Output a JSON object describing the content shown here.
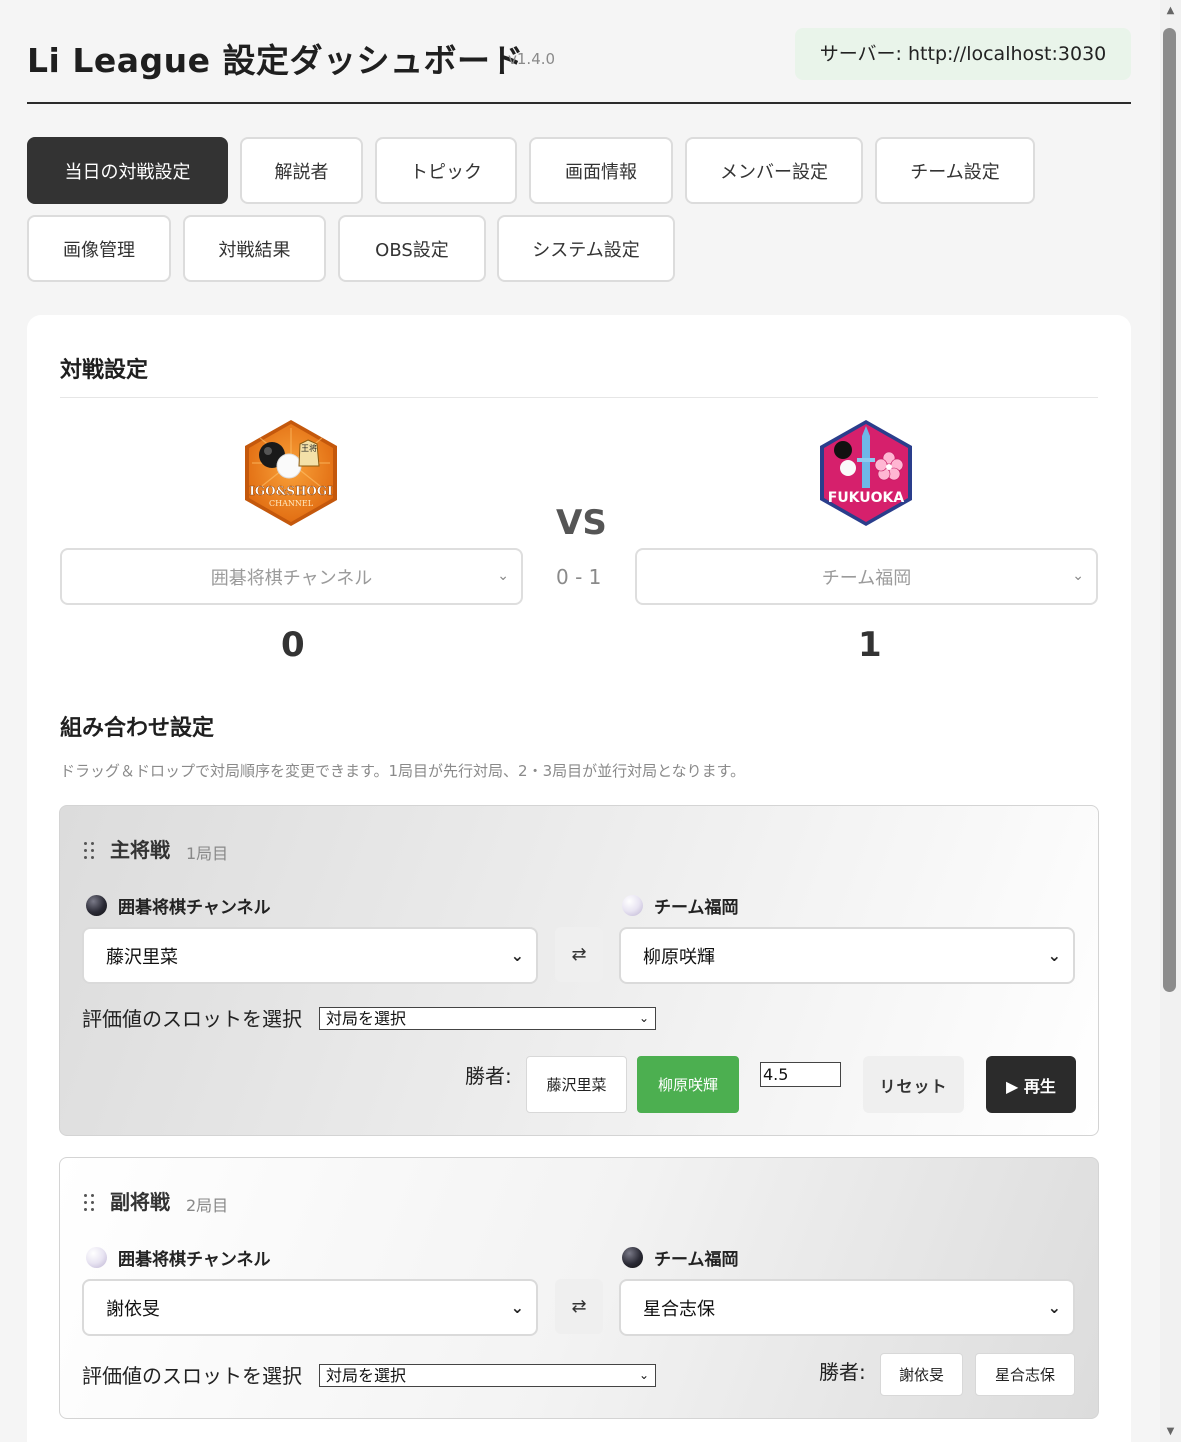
{
  "header": {
    "title": "Li League 設定ダッシュボード",
    "version": "v1.4.0",
    "server": "サーバー: http://localhost:3030"
  },
  "tabs": [
    {
      "label": "当日の対戦設定",
      "active": true
    },
    {
      "label": "解説者"
    },
    {
      "label": "トピック"
    },
    {
      "label": "画面情報"
    },
    {
      "label": "メンバー設定"
    },
    {
      "label": "チーム設定"
    },
    {
      "label": "画像管理"
    },
    {
      "label": "対戦結果"
    },
    {
      "label": "OBS設定"
    },
    {
      "label": "システム設定"
    }
  ],
  "match_setup": {
    "title": "対戦設定",
    "vs": "VS",
    "score_text": "0 - 1",
    "home": {
      "team": "囲碁将棋チャンネル",
      "score": "0",
      "logo_text": "IGO&SHOGI",
      "logo_subtext": "CHANNEL",
      "logo_badge": "王将"
    },
    "away": {
      "team": "チーム福岡",
      "score": "1",
      "logo_text": "FUKUOKA"
    }
  },
  "pairing": {
    "title": "組み合わせ設定",
    "hint": "ドラッグ＆ドロップで対局順序を変更できます。1局目が先行対局、2・3局目が並行対局となります。",
    "eval_label": "評価値のスロットを選択",
    "eval_placeholder": "対局を選択",
    "winner_label": "勝者:",
    "swap_symbol": "⇄",
    "matches": [
      {
        "title": "主将戦",
        "round": "1局目",
        "home_team": "囲碁将棋チャンネル",
        "home_stone": "black",
        "home_player": "藤沢里菜",
        "away_team": "チーム福岡",
        "away_stone": "white",
        "away_player": "柳原咲輝",
        "winner": "柳原咲輝",
        "score_input": "4.5",
        "reset": "リセット",
        "play": "▶ 再生"
      },
      {
        "title": "副将戦",
        "round": "2局目",
        "home_team": "囲碁将棋チャンネル",
        "home_stone": "white",
        "home_player": "謝依旻",
        "away_team": "チーム福岡",
        "away_stone": "black",
        "away_player": "星合志保"
      }
    ]
  },
  "colors": {
    "accent_dark": "#333333",
    "winner_green": "#4caf50",
    "server_badge_bg": "#e9f4ea",
    "logo_orange": "#f07d1a",
    "logo_magenta": "#d6206c"
  }
}
